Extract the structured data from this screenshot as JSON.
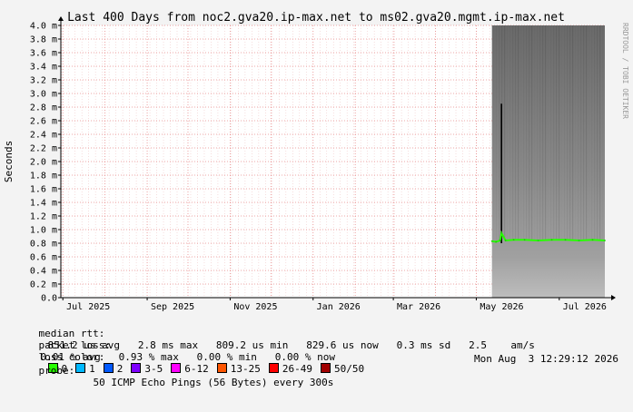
{
  "chart_data": {
    "type": "area",
    "title": "Last 400 Days from noc2.gva20.ip-max.net to ms02.gva20.mgmt.ip-max.net",
    "ylabel": "Seconds",
    "xlabel": "",
    "ylim": [
      0,
      4.0
    ],
    "y_ticks": [
      "0.0",
      "0.2 m",
      "0.4 m",
      "0.6 m",
      "0.8 m",
      "1.0 m",
      "1.2 m",
      "1.4 m",
      "1.6 m",
      "1.8 m",
      "2.0 m",
      "2.2 m",
      "2.4 m",
      "2.6 m",
      "2.8 m",
      "3.0 m",
      "3.2 m",
      "3.4 m",
      "3.6 m",
      "3.8 m",
      "4.0 m"
    ],
    "x_ticks": [
      "Jul 2025",
      "Sep 2025",
      "Nov 2025",
      "Jan 2026",
      "Mar 2026",
      "May 2026",
      "Jul 2026"
    ],
    "grid": true,
    "series": [
      {
        "name": "median rtt",
        "x": [
          "2026-05-12",
          "2026-05-15",
          "2026-05-18",
          "2026-05-19",
          "2026-05-22",
          "2026-05-28",
          "2026-06-05",
          "2026-06-15",
          "2026-06-25",
          "2026-07-05",
          "2026-07-15",
          "2026-07-25",
          "2026-08-03"
        ],
        "y": [
          0.83,
          0.82,
          0.84,
          0.95,
          0.84,
          0.85,
          0.85,
          0.84,
          0.85,
          0.85,
          0.84,
          0.85,
          0.84
        ]
      }
    ],
    "spike": {
      "x": "2026-05-19",
      "y": 2.85
    }
  },
  "watermark": "RRDTOOL / TOBI OETIKER",
  "stats": {
    "median_label": "median rtt:",
    "median_values": "851.2 us avg   2.8 ms max   809.2 us min   829.6 us now   0.3 ms sd   2.5    am/s",
    "loss_label": "packet loss:",
    "loss_values": "0.01 % avg   0.93 % max   0.00 % min   0.00 % now",
    "color_label": "loss color:",
    "probe_label": "probe:",
    "probe_values": "50 ICMP Echo Pings (56 Bytes) every 300s",
    "timestamp": "Mon Aug  3 12:29:12 2026"
  },
  "loss_colors": [
    {
      "label": "0",
      "color": "#26ff00"
    },
    {
      "label": "1",
      "color": "#00b8ff"
    },
    {
      "label": "2",
      "color": "#0059ff"
    },
    {
      "label": "3-5",
      "color": "#7e00ff"
    },
    {
      "label": "6-12",
      "color": "#ff00ff"
    },
    {
      "label": "13-25",
      "color": "#ff5500"
    },
    {
      "label": "26-49",
      "color": "#ff0000"
    },
    {
      "label": "50/50",
      "color": "#a10000"
    }
  ]
}
